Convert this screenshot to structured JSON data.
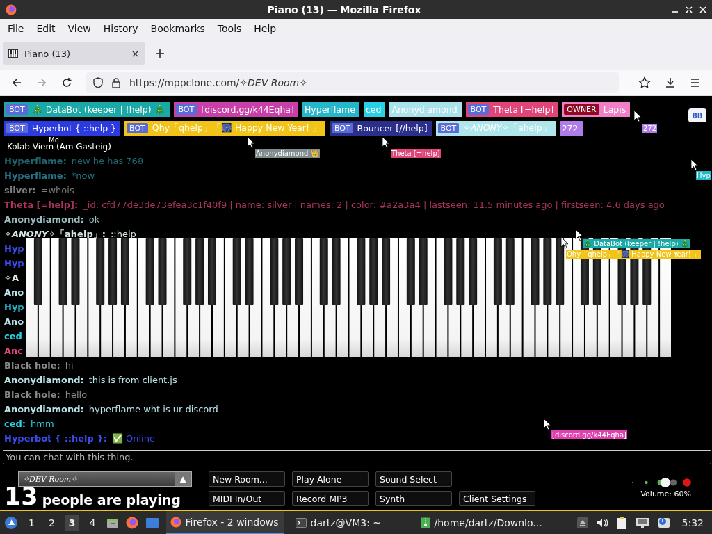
{
  "window": {
    "title": "Piano (13) — Mozilla Firefox"
  },
  "menu": [
    "File",
    "Edit",
    "View",
    "History",
    "Bookmarks",
    "Tools",
    "Help"
  ],
  "tabs": [
    {
      "label": "Piano (13)",
      "selected": true
    }
  ],
  "address": {
    "url": "https://mppclone.com/*✧DEV Room✧*"
  },
  "participants": {
    "lines": [
      {
        "badges": [
          {
            "name": "🎄 DataBot (keeper | !help) 🎄",
            "color": "#1aa9a6",
            "tag": {
              "kind": "bot",
              "label": "BOT"
            }
          },
          {
            "name": "[discord.gg/k44Eqha]",
            "color": "#c93fa8",
            "tag": {
              "kind": "bot",
              "label": "BOT"
            }
          },
          {
            "name": "Hyperflame",
            "color": "#25b7c9"
          },
          {
            "name": "ced",
            "color": "#2ad1e5"
          },
          {
            "name": "Anonydiamond",
            "color": "#a9e2ea"
          },
          {
            "name": "Theta [=help]",
            "color": "#e0457a",
            "tag": {
              "kind": "bot",
              "label": "BOT"
            }
          },
          {
            "name": "Lapis",
            "color": "#f07fc7",
            "tag": {
              "kind": "owner",
              "label": "OWNER"
            }
          }
        ]
      },
      {
        "badges": [
          {
            "name": "Hyperbot { ::help }",
            "color": "#2b3be0",
            "tag": {
              "kind": "bot",
              "label": "BOT"
            }
          },
          {
            "name": "Qhy「qhelp」「🎆 Happy New Year! 」",
            "color": "#f2c318",
            "tag": {
              "kind": "bot",
              "label": "BOT"
            }
          },
          {
            "name": "Bouncer [//help]",
            "color": "#2b2f8a",
            "tag": {
              "kind": "bot",
              "label": "BOT"
            }
          },
          {
            "name": "✧*ANONY*✧「ahelp」",
            "color": "#aee6ec",
            "tag": {
              "kind": "bot",
              "label": "BOT"
            }
          },
          {
            "name": "272",
            "color": "#b07de8"
          }
        ]
      }
    ]
  },
  "corner_button": "8B",
  "own_cursor": {
    "label": "Me",
    "tooltip": "Kolab Viem (Am Gasteig)"
  },
  "cursors": [
    {
      "name": "Anonydiamond 👑",
      "color": "#7f8c8e"
    },
    {
      "name": "Theta [=help]",
      "color": "#e0457a"
    },
    {
      "name": "272",
      "color": "#b07de8"
    },
    {
      "name": "Hyp",
      "color": "#25b7c9"
    },
    {
      "name": "🎄 DataBot (keeper | !help) 🎄",
      "color": "#1aa9a6"
    },
    {
      "name": "Qhy「qhelp」「🎆 Happy New Year! 」",
      "color": "#f2c318"
    },
    {
      "name": "[discord.gg/k44Eqha]",
      "color": "#e040b0"
    }
  ],
  "chat": [
    {
      "name": "Hyperflame:",
      "text": "new he has 768",
      "color": "#206470"
    },
    {
      "name": "Hyperflame:",
      "text": "*now",
      "color": "#267584"
    },
    {
      "name": "silver:",
      "text": "=whois",
      "color": "#7a7b7c"
    },
    {
      "name": "Theta [=help]:",
      "text": "_id: cfd77de3de73efea3c1f40f9 | name: silver | names: 2 | color: #a2a3a4 | lastseen: 11.5 minutes ago | firstseen: 4.6 days ago",
      "color": "#a8345c"
    },
    {
      "name": "Anonydiamond:",
      "text": "ok",
      "color": "#9bbcc2"
    },
    {
      "name": "✧*ANONY*✧「ahelp」:",
      "text": "::help",
      "color": "#d6e6e8"
    },
    {
      "name": "Hyp",
      "color": "#3b4cf0"
    },
    {
      "name": "Hyp",
      "color": "#3b4cf0"
    },
    {
      "name": "✧A",
      "color": "#d6e6e8"
    },
    {
      "name": "Ano",
      "color": "#b8e3ea"
    },
    {
      "name": "Hyp",
      "color": "#25b7c9"
    },
    {
      "name": "Ano",
      "color": "#b8e3ea"
    },
    {
      "name": "ced",
      "color": "#2ad1e5"
    },
    {
      "name": "Anc",
      "color": "#e0457a"
    },
    {
      "name": "Black hole:",
      "text": "hi",
      "color": "#8a8a8a"
    },
    {
      "name": "Anonydiamond:",
      "text": "this is from client.js",
      "color": "#b8e3ea"
    },
    {
      "name": "Black hole:",
      "text": "hello",
      "color": "#8a8a8a"
    },
    {
      "name": "Anonydiamond:",
      "text": "hyperflame wht is ur discord",
      "color": "#b8e3ea"
    },
    {
      "name": "ced:",
      "text": "hmm",
      "color": "#2ad1e5"
    },
    {
      "name": "Hyperbot { ::help }:",
      "text": "✅ Online",
      "color": "#3b4cf0"
    }
  ],
  "chat_input": {
    "placeholder": "You can chat with this thing."
  },
  "room": {
    "name": "✧DEV Room✧",
    "arrow": "▲"
  },
  "player_count": {
    "number": "13",
    "label": "people are playing"
  },
  "button_rows": [
    [
      "New Room...",
      "Play Alone",
      "Sound Select"
    ],
    [
      "MIDI In/Out",
      "Record MP3",
      "Synth",
      "Client Settings"
    ]
  ],
  "volume": {
    "label": "Volume: 60%"
  },
  "taskbar": {
    "workspaces": [
      {
        "label": "1",
        "selected": false
      },
      {
        "label": "2",
        "selected": false
      },
      {
        "label": "3",
        "selected": true
      },
      {
        "label": "4",
        "selected": false
      }
    ],
    "tasks": [
      {
        "label": "Firefox - 2 windows",
        "kind": "browser",
        "selected": true
      },
      {
        "label": "dartz@VM3: ~",
        "kind": "terminal",
        "selected": false
      },
      {
        "label": "/home/dartz/Downlo...",
        "kind": "archive",
        "selected": false
      }
    ],
    "clock": "5:32"
  }
}
